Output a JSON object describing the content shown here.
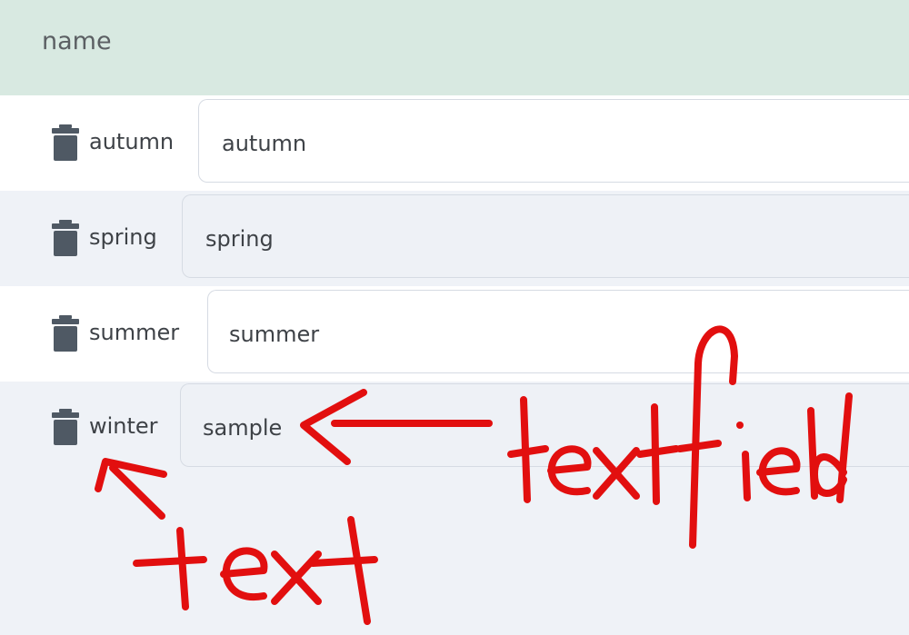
{
  "header": {
    "column_label": "name"
  },
  "rows": [
    {
      "label": "autumn",
      "value": "autumn",
      "delete_icon": "trash-icon"
    },
    {
      "label": "spring",
      "value": "spring",
      "delete_icon": "trash-icon"
    },
    {
      "label": "summer",
      "value": "summer",
      "delete_icon": "trash-icon"
    },
    {
      "label": "winter",
      "value": "sample",
      "delete_icon": "trash-icon"
    }
  ],
  "annotations": {
    "textfield_label": "textfield",
    "text_label": "text",
    "color": "#e20f0f"
  },
  "colors": {
    "header_bg": "#d8e9e1",
    "row_white": "#ffffff",
    "row_grey": "#eff2f7",
    "icon": "#4f5964"
  }
}
